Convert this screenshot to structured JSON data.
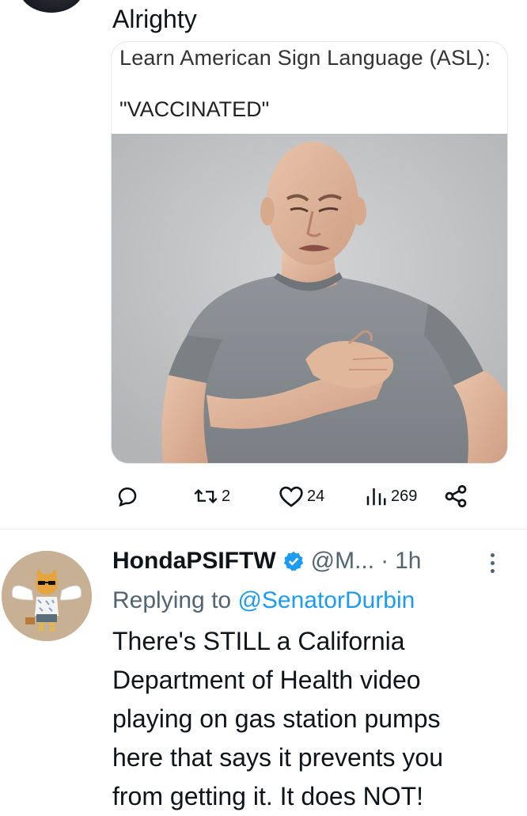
{
  "tweet1": {
    "reply_text": "Alrighty",
    "media": {
      "line1": "Learn American Sign Language (ASL):",
      "line2": "\"VACCINATED\""
    },
    "actions": {
      "reply": {
        "icon": "speech-bubble-icon",
        "count": ""
      },
      "retweet": {
        "icon": "retweet-icon",
        "count": "2"
      },
      "like": {
        "icon": "heart-icon",
        "count": "24"
      },
      "views": {
        "icon": "bar-chart-icon",
        "count": "269"
      },
      "share": {
        "icon": "share-icon"
      }
    }
  },
  "tweet2": {
    "name": "HondaPSIFTW",
    "handle": "@M...",
    "separator": "·",
    "time": "1h",
    "replying_prefix": "Replying to ",
    "replying_mention": "@SenatorDurbin",
    "body_lines": [
      "There's STILL a California",
      "Department of Health video",
      "playing on gas station pumps",
      "here that says it prevents you",
      "from getting it.  It does NOT!"
    ]
  },
  "colors": {
    "text": "#0f1419",
    "secondary": "#536471",
    "accent": "#1d9bf0"
  }
}
